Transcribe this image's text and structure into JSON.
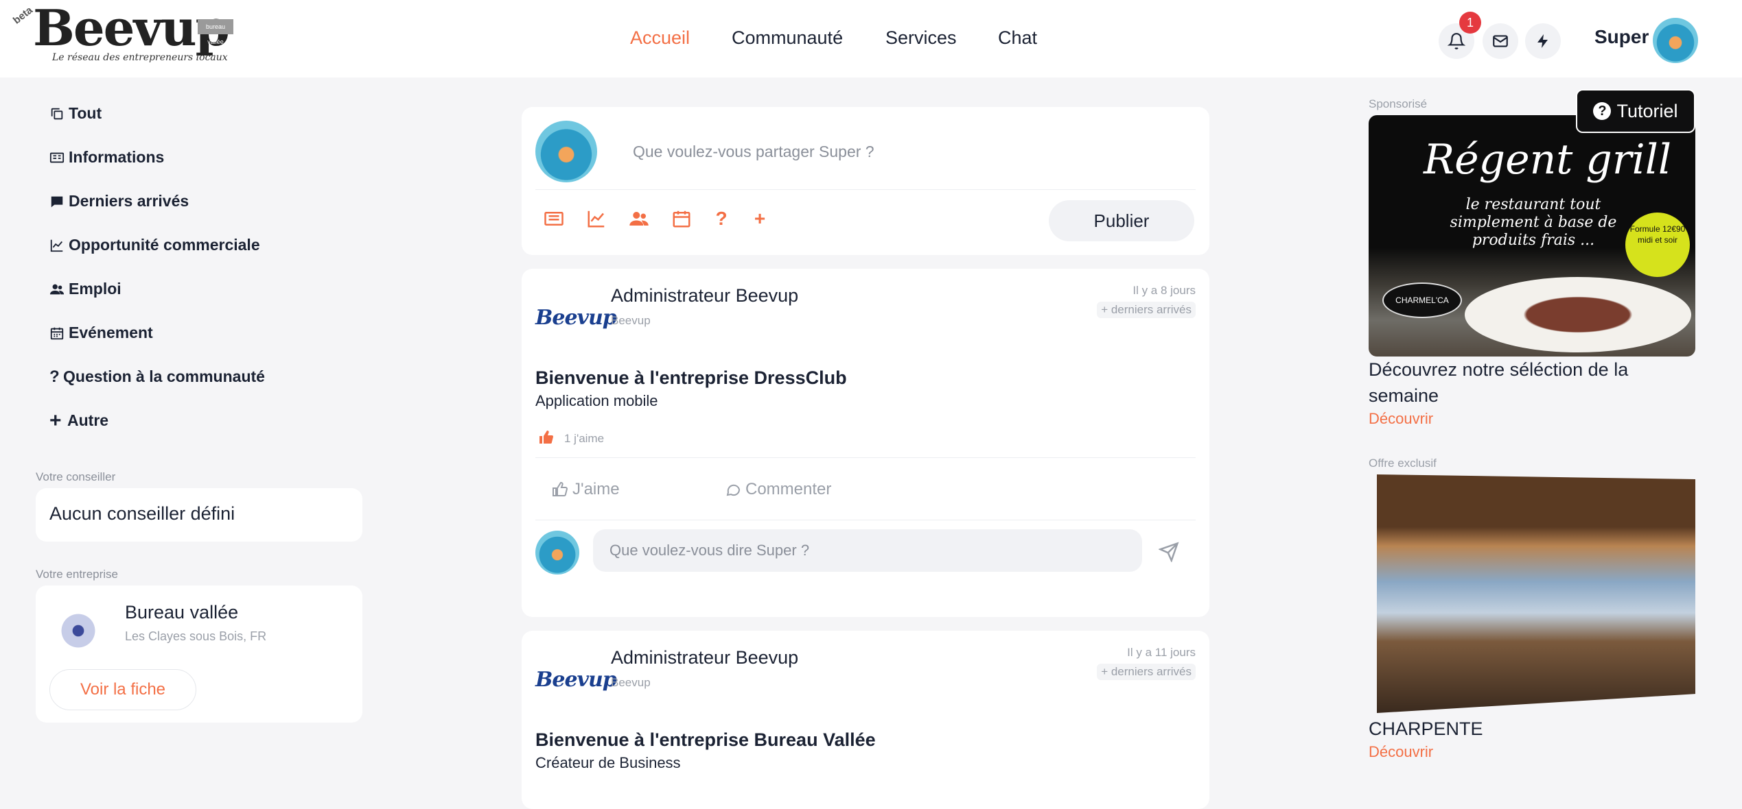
{
  "header": {
    "logo_text": "Beevup",
    "logo_beta": "beta",
    "logo_badge": "bureau vallée",
    "tagline": "Le réseau des entrepreneurs locaux",
    "nav": [
      "Accueil",
      "Communauté",
      "Services",
      "Chat"
    ],
    "active_nav": "Accueil",
    "notification_count": "1",
    "user_name": "Super",
    "icons": [
      "bell-icon",
      "mail-icon",
      "bolt-icon"
    ]
  },
  "sidebar": {
    "items": [
      {
        "label": "Tout",
        "icon": "copy-icon"
      },
      {
        "label": "Informations",
        "icon": "newspaper-icon"
      },
      {
        "label": "Derniers arrivés",
        "icon": "comment-icon"
      },
      {
        "label": "Opportunité commerciale",
        "icon": "chart-line-icon"
      },
      {
        "label": "Emploi",
        "icon": "users-icon"
      },
      {
        "label": "Evénement",
        "icon": "calendar-icon"
      },
      {
        "label": "Question à la communauté",
        "icon": "question-icon"
      },
      {
        "label": "Autre",
        "icon": "plus-icon"
      }
    ],
    "advisor_label": "Votre conseiller",
    "advisor_value": "Aucun conseiller défini",
    "company_label": "Votre entreprise",
    "company_name": "Bureau vallée",
    "company_location": "Les Clayes sous Bois, FR",
    "company_button": "Voir la fiche"
  },
  "composer": {
    "placeholder": "Que voulez-vous partager Super ?",
    "publish_label": "Publier",
    "tools": [
      "newspaper-icon",
      "chart-line-icon",
      "users-icon",
      "calendar-icon",
      "question-icon",
      "plus-icon"
    ]
  },
  "posts": [
    {
      "logo": "Beevup",
      "author": "Administrateur Beevup",
      "sub": "Beevup",
      "time": "Il y a 8 jours",
      "tag": "+ derniers arrivés",
      "title": "Bienvenue à l'entreprise DressClub",
      "desc": "Application mobile",
      "likes": "1 j'aime",
      "like_label": "J'aime",
      "comment_label": "Commenter",
      "comment_placeholder": "Que voulez-vous dire Super ?"
    },
    {
      "logo": "Beevup",
      "author": "Administrateur Beevup",
      "sub": "Beevup",
      "time": "Il y a 11 jours",
      "tag": "+ derniers arrivés",
      "title": "Bienvenue à l'entreprise Bureau Vallée",
      "desc": "Créateur de Business"
    }
  ],
  "right": {
    "tutorial_label": "Tutoriel",
    "ads": [
      {
        "label": "Sponsorisé",
        "img_title": "Régent grill",
        "img_sub": "le restaurant tout simplement à base de produits frais ...",
        "img_badge": "Formule 12€90 midi et soir",
        "img_logo": "CHARMEL'CA",
        "title": "Découvrez notre séléction de la semaine",
        "link": "Découvrir"
      },
      {
        "label": "Offre exclusif",
        "title": "CHARPENTE",
        "link": "Découvrir"
      }
    ]
  },
  "colors": {
    "accent": "#f36f45",
    "text": "#1b2233",
    "muted": "#9a9fa8",
    "background": "#f5f5f7",
    "badge": "#e5393f"
  }
}
